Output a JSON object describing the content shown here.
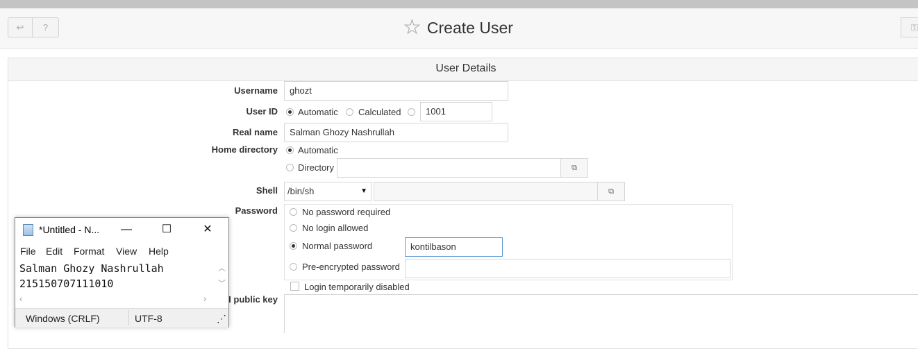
{
  "header": {
    "back_icon": "↩",
    "help_icon": "?",
    "key_icon": "⚿",
    "title": "Create User"
  },
  "panel": {
    "title": "User Details"
  },
  "form": {
    "username": {
      "label": "Username",
      "value": "ghozt"
    },
    "userid": {
      "label": "User ID",
      "opt_automatic": "Automatic",
      "opt_calculated": "Calculated",
      "value": "1001"
    },
    "realname": {
      "label": "Real name",
      "value": "Salman Ghozy Nashrullah"
    },
    "homedir": {
      "label": "Home directory",
      "opt_automatic": "Automatic",
      "opt_directory": "Directory",
      "value": ""
    },
    "shell": {
      "label": "Shell",
      "value": "/bin/sh",
      "arrow": "▼"
    },
    "password": {
      "label": "Password",
      "opt_none": "No password required",
      "opt_nologin": "No login allowed",
      "opt_normal": "Normal password",
      "normal_value": "kontilbason",
      "opt_preenc": "Pre-encrypted password",
      "preenc_value": ""
    },
    "login_disabled": "Login temporarily disabled",
    "ssh_key_label": "H public key"
  },
  "notepad": {
    "title": "*Untitled - N...",
    "minimize": "—",
    "maximize": "☐",
    "close": "✕",
    "menu": [
      "File",
      "Edit",
      "Format",
      "View",
      "Help"
    ],
    "content": "Salman Ghozy Nashrullah\n215150707111010",
    "status_eol": "Windows (CRLF)",
    "status_enc": "UTF-8"
  }
}
